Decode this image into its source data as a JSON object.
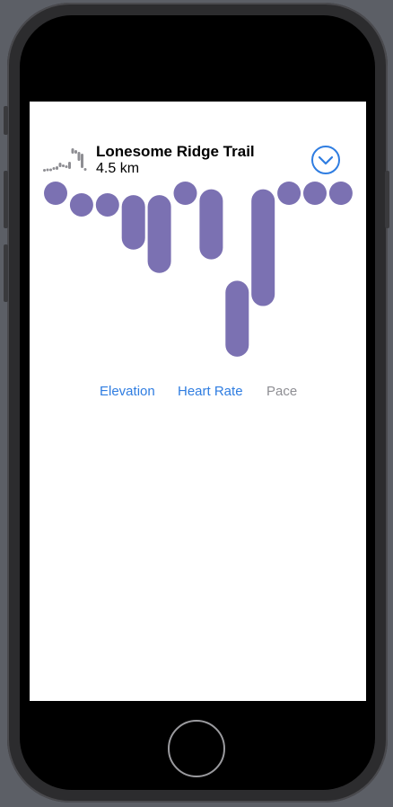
{
  "trail": {
    "name": "Lonesome Ridge Trail",
    "distance": "4.5 km"
  },
  "icons": {
    "trail_sparkline": "elevation-sparkline-icon",
    "collapse": "chevron-down-circle-icon"
  },
  "colors": {
    "bar": "#7b71b2",
    "accent": "#2f7de1",
    "inactive_tab": "#8e8e93"
  },
  "tabs": [
    {
      "label": "Elevation",
      "active": true
    },
    {
      "label": "Heart Rate",
      "active": true
    },
    {
      "label": "Pace",
      "active": false
    }
  ],
  "chart_data": {
    "type": "bar",
    "series": [
      {
        "values": [
          {
            "low": 0,
            "high": 0.4
          },
          {
            "low": 0.3,
            "high": 0.8
          },
          {
            "low": 0.3,
            "high": 0.8
          },
          {
            "low": 0.35,
            "high": 1.75
          },
          {
            "low": 0.35,
            "high": 2.35
          },
          {
            "low": 0,
            "high": 0.4
          },
          {
            "low": 0.2,
            "high": 2.0
          },
          {
            "low": 2.55,
            "high": 4.5
          },
          {
            "low": 0.2,
            "high": 3.2
          },
          {
            "low": 0,
            "high": 0.4
          },
          {
            "low": 0,
            "high": 0.4
          },
          {
            "low": 0,
            "high": 0.4
          }
        ]
      }
    ]
  }
}
